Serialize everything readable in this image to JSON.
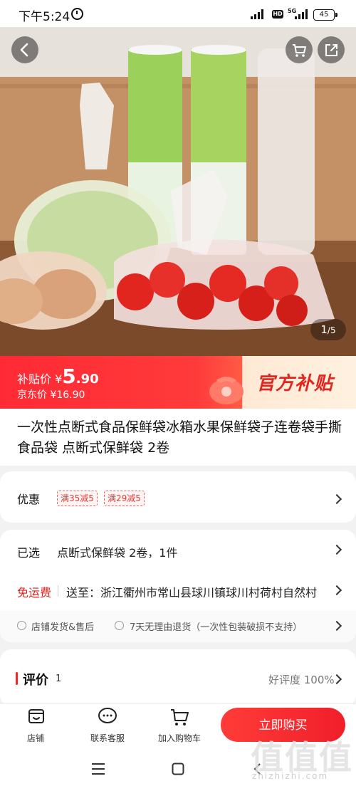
{
  "status_bar": {
    "time": "下午5:24",
    "battery": "45"
  },
  "gallery": {
    "counter_current": "1",
    "counter_total": "/5"
  },
  "price": {
    "subsidy_label": "补贴价",
    "currency": "¥",
    "subsidy_int": "5",
    "subsidy_dec": ".90",
    "jd_label": "京东价",
    "jd_price": "¥16.90",
    "official_badge": "官方补贴"
  },
  "product": {
    "title": "一次性点断式食品保鲜袋冰箱水果保鲜袋子连卷袋手撕食品袋 点断式保鲜袋 2卷"
  },
  "promo": {
    "label": "优惠",
    "tags": [
      "满35减5",
      "满29减5"
    ]
  },
  "selection": {
    "label": "已选",
    "value": "点断式保鲜袋 2卷，1件"
  },
  "shipping": {
    "free_label": "免运费",
    "ship_to": "送至：浙江衢州市常山县球川镇球川村荷村自然村"
  },
  "service": {
    "item1": "店铺发货&售后",
    "item2": "7天无理由退货（一次性包装破损不支持）"
  },
  "reviews": {
    "label": "评价",
    "count": "1",
    "rating": "好评度 100%"
  },
  "bottom_bar": {
    "store": "店铺",
    "service": "联系客服",
    "cart": "加入购物车",
    "buy": "立即购买"
  },
  "watermark": {
    "main": "值值值",
    "sub": "zhizhizhi.com"
  },
  "colors": {
    "accent": "#f0262c",
    "tag": "#e83a33"
  }
}
